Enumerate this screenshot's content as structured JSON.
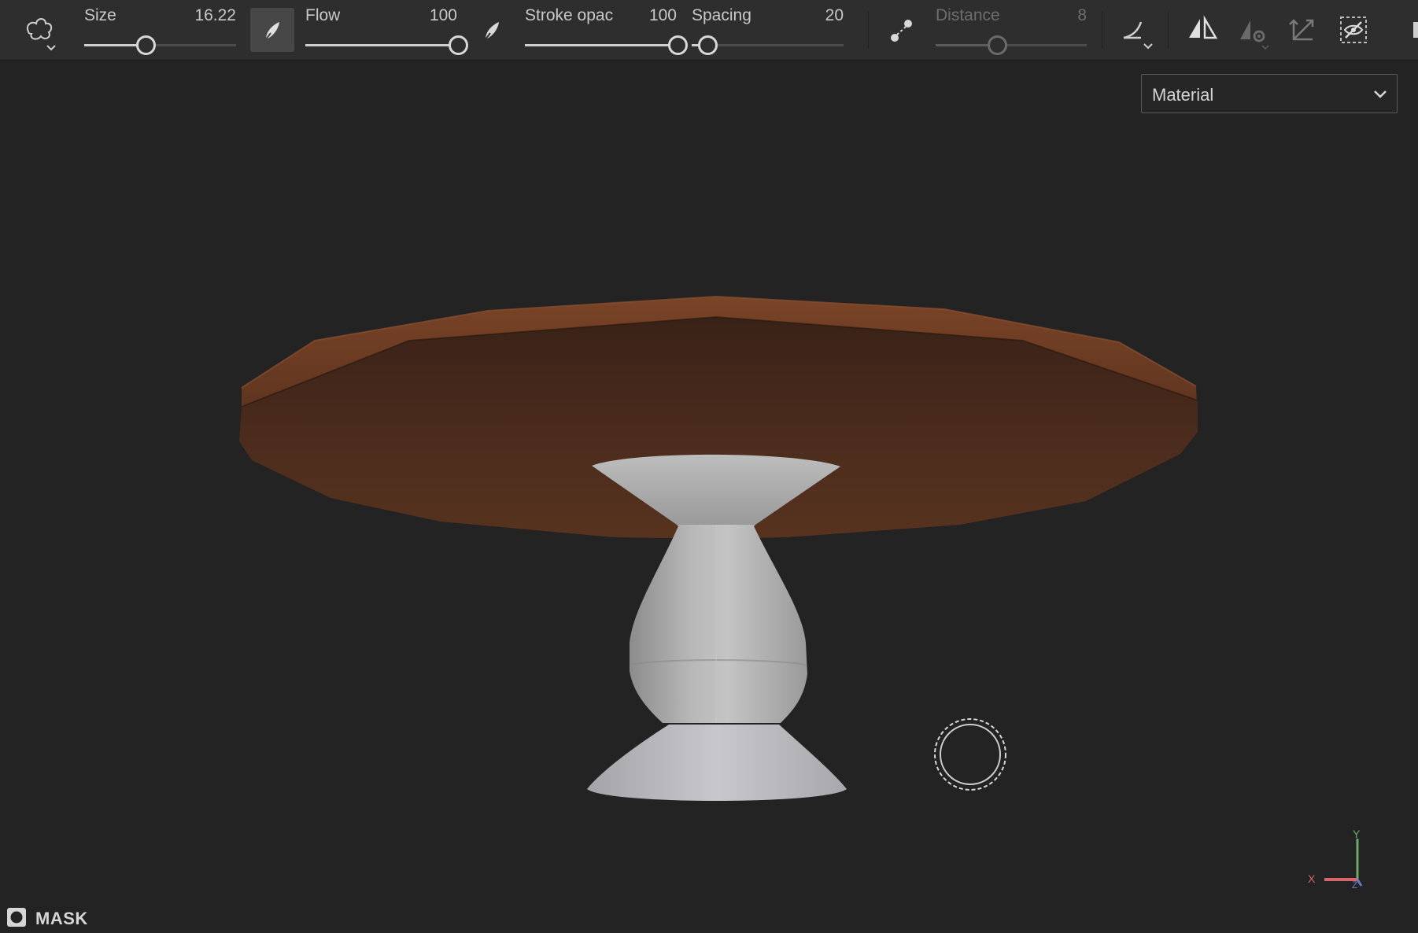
{
  "toolbar": {
    "brush_shape_icon": "blob-brush-icon",
    "size": {
      "label": "Size",
      "value": "16.22",
      "fraction": 0.4
    },
    "flow": {
      "label": "Flow",
      "value": "100",
      "fraction": 1.0
    },
    "stroke_opacity": {
      "label": "Stroke opac",
      "value": "100",
      "fraction": 1.0
    },
    "spacing": {
      "label": "Spacing",
      "value": "20",
      "fraction": 0.1
    },
    "distance": {
      "label": "Distance",
      "value": "8",
      "fraction": 0.4,
      "enabled": false
    },
    "icons": {
      "flow_pen": "pen-nib-icon",
      "opacity_pen": "pen-nib-icon",
      "lazy_mouse": "lazy-mouse-icon",
      "alignment": "tangent-alignment-icon",
      "symmetry": "symmetry-icon",
      "symmetry_settings": "symmetry-settings-icon",
      "projection": "projection-axis-icon",
      "hide_selection": "hidden-selection-icon"
    }
  },
  "viewport": {
    "projection_mode": "Material",
    "mask_label": "MASK",
    "axes": {
      "x": "X",
      "y": "Y",
      "z": "Z"
    },
    "axis_colors": {
      "x": "#d6666e",
      "y": "#6ea86a",
      "z": "#6a78c8"
    }
  },
  "colors": {
    "toolbar_bg": "#2e2e2e",
    "viewport_bg": "#232323",
    "table_top": "#4a2a1b",
    "table_base": "#b9b9b9"
  }
}
